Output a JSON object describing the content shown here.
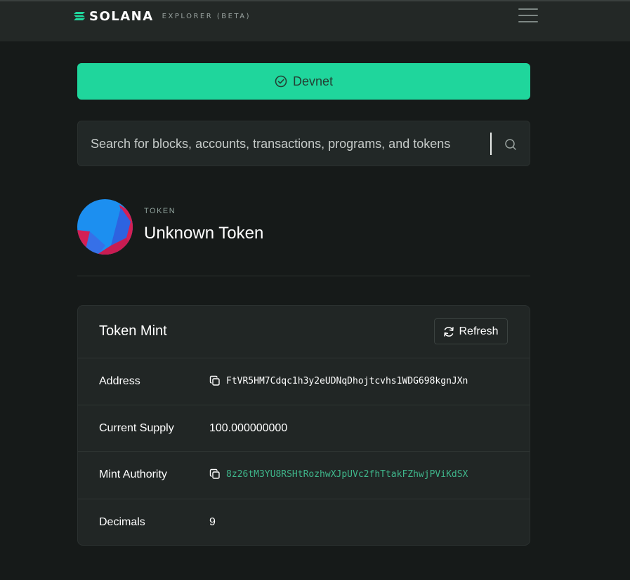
{
  "header": {
    "brand": "SOLANA",
    "subtitle": "EXPLORER (BETA)",
    "menu_icon": "hamburger-menu-icon"
  },
  "cluster": {
    "label": "Devnet",
    "icon": "check-circle-icon"
  },
  "search": {
    "placeholder": "Search for blocks, accounts, transactions, programs, and tokens",
    "icon": "search-icon"
  },
  "token": {
    "kicker": "TOKEN",
    "title": "Unknown Token"
  },
  "mint_card": {
    "title": "Token Mint",
    "refresh_label": "Refresh",
    "rows": [
      {
        "label": "Address",
        "value": "FtVR5HM7Cdqc1h3y2eUDNqDhojtcvhs1WDG698kgnJXn"
      },
      {
        "label": "Current Supply",
        "value": "100.000000000"
      },
      {
        "label": "Mint Authority",
        "value": "8z26tM3YU8RSHtRozhwXJpUVc2fhTtakFZhwjPViKdSX"
      },
      {
        "label": "Decimals",
        "value": "9"
      }
    ]
  },
  "colors": {
    "accent": "#1fd69c",
    "link": "#3fb68b",
    "background": "#161a19",
    "card": "#212625"
  }
}
